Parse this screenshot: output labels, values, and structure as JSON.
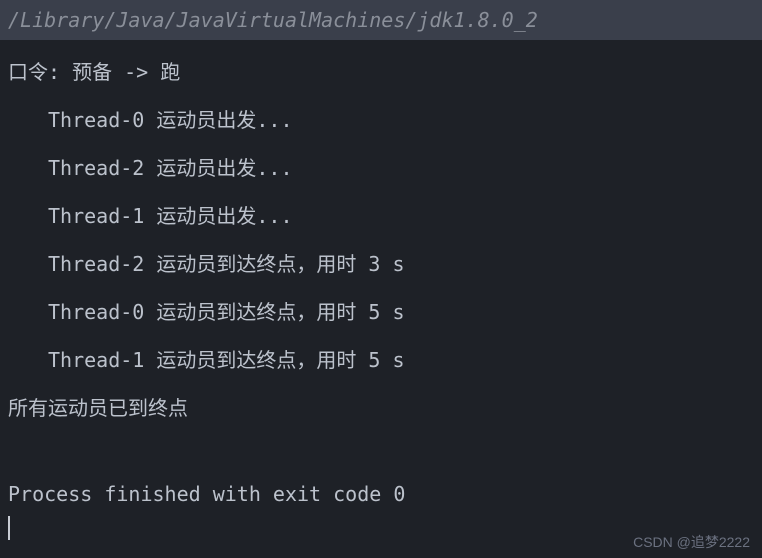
{
  "console": {
    "path": "/Library/Java/JavaVirtualMachines/jdk1.8.0_2",
    "lines": [
      {
        "text": "口令: 预备 -> 跑",
        "indented": false
      },
      {
        "text": "Thread-0 运动员出发...",
        "indented": true
      },
      {
        "text": "Thread-2 运动员出发...",
        "indented": true
      },
      {
        "text": "Thread-1 运动员出发...",
        "indented": true
      },
      {
        "text": "Thread-2 运动员到达终点，用时 3 s",
        "indented": true
      },
      {
        "text": "Thread-0 运动员到达终点，用时 5 s",
        "indented": true
      },
      {
        "text": "Thread-1 运动员到达终点，用时 5 s",
        "indented": true
      },
      {
        "text": "所有运动员已到终点",
        "indented": false
      }
    ],
    "exit_message": "Process finished with exit code 0"
  },
  "watermark": "CSDN @追梦2222"
}
